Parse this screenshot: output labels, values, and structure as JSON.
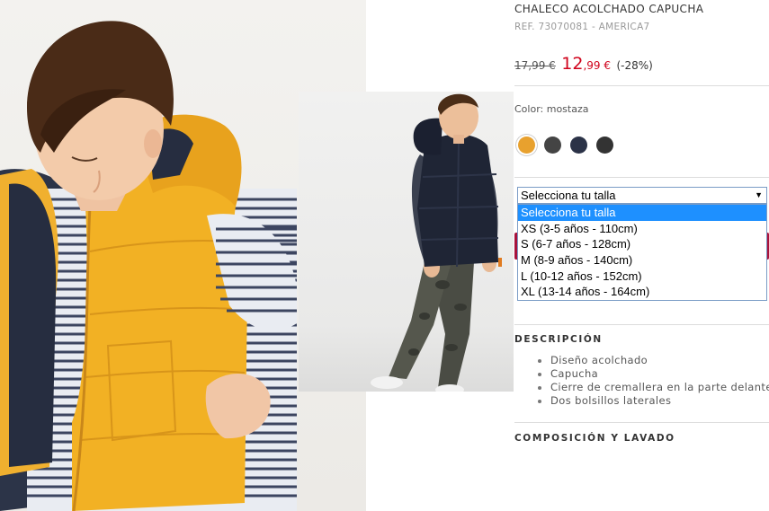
{
  "product": {
    "title": "CHALECO ACOLCHADO CAPUCHA",
    "ref": "REF. 73070081 - AMERICA7",
    "old_price": "17,99 €",
    "new_price_int": "12",
    "new_price_dec": ",99 €",
    "discount": "(-28%)"
  },
  "color": {
    "label": "Color: mostaza",
    "swatches": [
      {
        "name": "mostaza",
        "hex": "#e8a12e",
        "selected": true
      },
      {
        "name": "gris oscuro",
        "hex": "#444444",
        "selected": false
      },
      {
        "name": "azul marino",
        "hex": "#2b3247",
        "selected": false
      },
      {
        "name": "negro",
        "hex": "#333333",
        "selected": false
      }
    ]
  },
  "size": {
    "selected": "Selecciona tu talla",
    "options": [
      "Selecciona tu talla",
      "XS (3-5 años - 110cm)",
      "S (6-7 años - 128cm)",
      "M (8-9 años - 140cm)",
      "L (10-12 años - 152cm)",
      "XL (13-14 años - 164cm)"
    ]
  },
  "description": {
    "title": "DESCRIPCIÓN",
    "items": [
      "Diseño acolchado",
      "Capucha",
      "Cierre de cremallera en la parte delantera",
      "Dos bolsillos laterales"
    ]
  },
  "composition": {
    "title": "COMPOSICIÓN Y LAVADO"
  },
  "colors": {
    "sale_red": "#d0021b",
    "select_highlight": "#1e90ff",
    "accent_button": "#a8123c"
  }
}
